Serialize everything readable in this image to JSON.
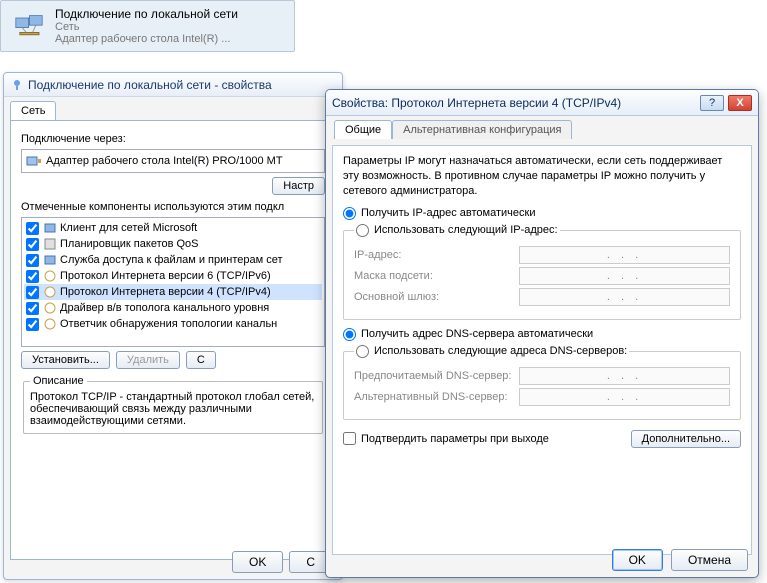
{
  "connection_card": {
    "title": "Подключение по локальной сети",
    "network": "Сеть",
    "adapter": "Адаптер рабочего стола Intel(R) ..."
  },
  "props_window": {
    "title": "Подключение по локальной сети - свойства",
    "tab_network": "Сеть",
    "connect_via_label": "Подключение через:",
    "adapter_text": "Адаптер рабочего стола Intel(R) PRO/1000 MT",
    "configure_btn": "Настр",
    "components_label": "Отмеченные компоненты используются этим подкл",
    "components": [
      "Клиент для сетей Microsoft",
      "Планировщик пакетов QoS",
      "Служба доступа к файлам и принтерам сет",
      "Протокол Интернета версии 6 (TCP/IPv6)",
      "Протокол Интернета версии 4 (TCP/IPv4)",
      "Драйвер в/в тополога канального уровня",
      "Ответчик обнаружения топологии канальн"
    ],
    "install_btn": "Установить...",
    "uninstall_btn": "Удалить",
    "properties_btn": "С",
    "description_legend": "Описание",
    "description_text": "Протокол TCP/IP - стандартный протокол глобал сетей, обеспечивающий связь между различными взаимодействующими сетями.",
    "ok": "OK",
    "cancel": "С"
  },
  "ipv4_window": {
    "title": "Свойства: Протокол Интернета версии 4 (TCP/IPv4)",
    "help_glyph": "?",
    "close_glyph": "X",
    "tab_general": "Общие",
    "tab_alt": "Альтернативная конфигурация",
    "info": "Параметры IP могут назначаться автоматически, если сеть поддерживает эту возможность. В противном случае параметры IP можно получить у сетевого администратора.",
    "radio_auto_ip": "Получить IP-адрес автоматически",
    "radio_manual_ip": "Использовать следующий IP-адрес:",
    "ip_label": "IP-адрес:",
    "mask_label": "Маска подсети:",
    "gateway_label": "Основной шлюз:",
    "radio_auto_dns": "Получить адрес DNS-сервера автоматически",
    "radio_manual_dns": "Использовать следующие адреса DNS-серверов:",
    "dns1_label": "Предпочитаемый DNS-сервер:",
    "dns2_label": "Альтернативный DNS-сервер:",
    "confirm_on_exit": "Подтвердить параметры при выходе",
    "advanced_btn": "Дополнительно...",
    "ok": "OK",
    "cancel": "Отмена",
    "ip_dots": ".   .   ."
  }
}
